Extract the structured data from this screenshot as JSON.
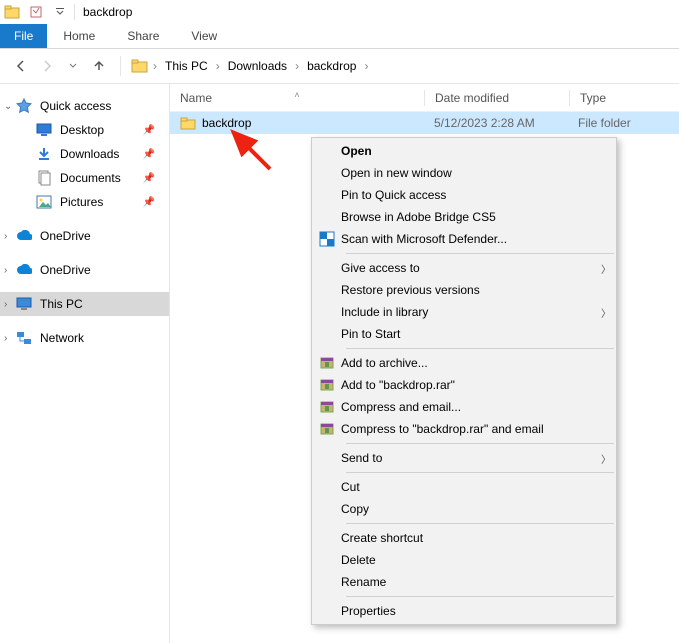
{
  "title": "backdrop",
  "ribbon": {
    "file": "File",
    "tabs": [
      "Home",
      "Share",
      "View"
    ]
  },
  "breadcrumb": [
    "This PC",
    "Downloads",
    "backdrop"
  ],
  "sidebar": {
    "quick_access": {
      "label": "Quick access",
      "items": [
        {
          "label": "Desktop",
          "pinned": true
        },
        {
          "label": "Downloads",
          "pinned": true
        },
        {
          "label": "Documents",
          "pinned": true
        },
        {
          "label": "Pictures",
          "pinned": true
        }
      ]
    },
    "onedrive1": "OneDrive",
    "onedrive2": "OneDrive",
    "this_pc": "This PC",
    "network": "Network"
  },
  "columns": {
    "name": "Name",
    "date": "Date modified",
    "type": "Type"
  },
  "rows": [
    {
      "name": "backdrop",
      "date": "5/12/2023 2:28 AM",
      "type": "File folder"
    }
  ],
  "context_menu": {
    "open": "Open",
    "open_new_window": "Open in new window",
    "pin_quick_access": "Pin to Quick access",
    "browse_bridge": "Browse in Adobe Bridge CS5",
    "scan_defender": "Scan with Microsoft Defender...",
    "give_access": "Give access to",
    "restore_prev": "Restore previous versions",
    "include_library": "Include in library",
    "pin_start": "Pin to Start",
    "add_archive": "Add to archive...",
    "add_backdrop_rar": "Add to \"backdrop.rar\"",
    "compress_email": "Compress and email...",
    "compress_backdrop_email": "Compress to \"backdrop.rar\" and email",
    "send_to": "Send to",
    "cut": "Cut",
    "copy": "Copy",
    "create_shortcut": "Create shortcut",
    "delete": "Delete",
    "rename": "Rename",
    "properties": "Properties"
  }
}
